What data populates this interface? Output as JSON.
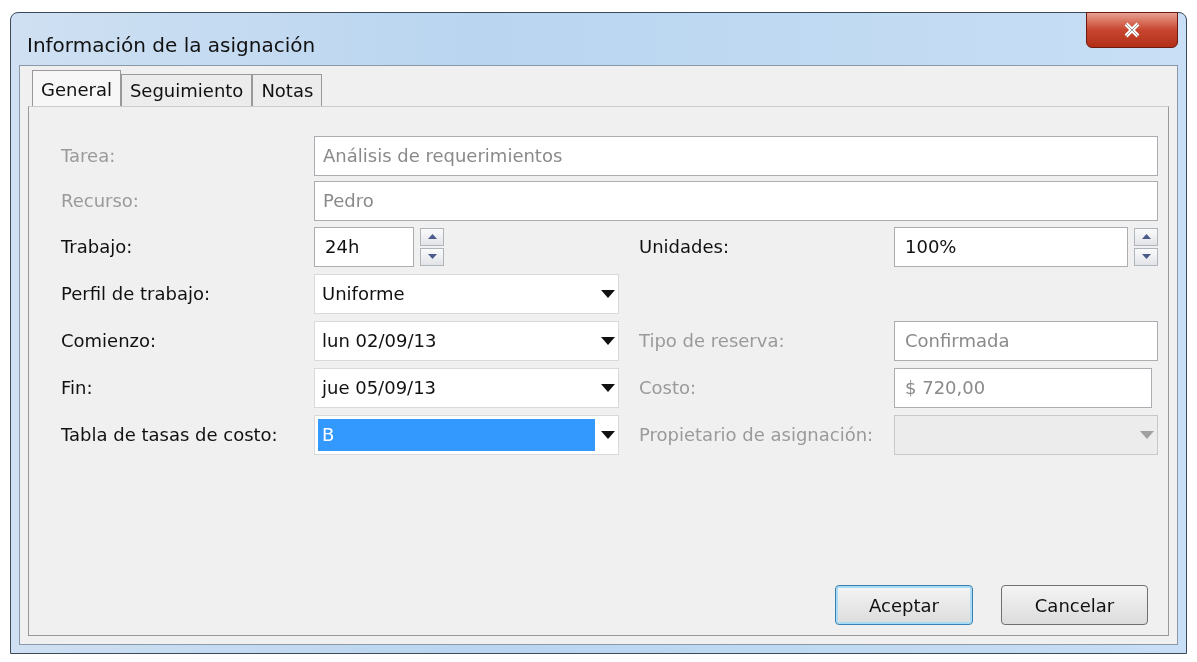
{
  "window": {
    "title": "Información de la asignación"
  },
  "tabs": [
    {
      "label": "General",
      "selected": true
    },
    {
      "label": "Seguimiento",
      "selected": false
    },
    {
      "label": "Notas",
      "selected": false
    }
  ],
  "wide_fields": [
    {
      "label": "Tarea:",
      "value": "Análisis de requerimientos",
      "disabled": true
    },
    {
      "label": "Recurso:",
      "value": "Pedro",
      "disabled": true
    }
  ],
  "rows": [
    {
      "left": {
        "kind": "spin",
        "label": "Trabajo:",
        "value": "24h",
        "disabled": false,
        "highlighted": false
      },
      "right": {
        "kind": "spin",
        "label": "Unidades:",
        "value": "100%",
        "disabled": false,
        "highlighted": false
      }
    },
    {
      "left": {
        "kind": "combo",
        "label": "Perfil de trabajo:",
        "value": "Uniforme",
        "disabled": false,
        "highlighted": false
      }
    },
    {
      "left": {
        "kind": "combo",
        "label": "Comienzo:",
        "value": "lun 02/09/13",
        "disabled": false,
        "highlighted": false
      },
      "right": {
        "kind": "text",
        "label": "Tipo de reserva:",
        "value": "Confirmada",
        "disabled": true,
        "highlighted": false
      }
    },
    {
      "left": {
        "kind": "combo",
        "label": "Fin:",
        "value": "jue 05/09/13",
        "disabled": false,
        "highlighted": false
      },
      "right": {
        "kind": "text",
        "label": "Costo:",
        "value": "$ 720,00",
        "disabled": true,
        "highlighted": false
      }
    },
    {
      "left": {
        "kind": "combo",
        "label": "Tabla de tasas de costo:",
        "value": "B",
        "disabled": false,
        "highlighted": true
      },
      "right": {
        "kind": "combo",
        "label": "Propietario de asignación:",
        "disabled": true,
        "highlighted": false
      }
    }
  ],
  "buttons": [
    {
      "label": "Aceptar",
      "default": true
    },
    {
      "label": "Cancelar",
      "default": false
    }
  ]
}
